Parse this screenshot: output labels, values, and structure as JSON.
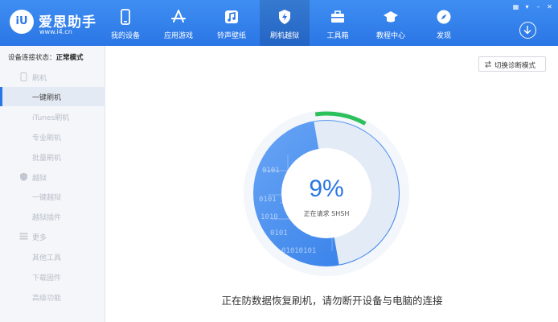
{
  "app": {
    "name": "爱思助手",
    "url": "www.i4.cn",
    "logo_mark": "iU"
  },
  "nav": [
    {
      "label": "我的设备",
      "icon": "phone-icon"
    },
    {
      "label": "应用游戏",
      "icon": "app-store-icon"
    },
    {
      "label": "铃声壁纸",
      "icon": "music-icon"
    },
    {
      "label": "刷机越狱",
      "icon": "flash-icon",
      "active": true
    },
    {
      "label": "工具箱",
      "icon": "toolbox-icon"
    },
    {
      "label": "教程中心",
      "icon": "graduation-cap-icon"
    },
    {
      "label": "发现",
      "icon": "compass-icon"
    }
  ],
  "window_controls": [
    "▦",
    "▾",
    "–",
    "✕"
  ],
  "sidebar": {
    "status_label": "设备连接状态：",
    "status_value": "正常模式",
    "sections": [
      {
        "label": "刷机",
        "icon": "flash-icon",
        "items": [
          "一键刷机",
          "iTunes刷机",
          "专业刷机",
          "批量刷机"
        ]
      },
      {
        "label": "越狱",
        "icon": "shield-icon",
        "items": [
          "一键越狱",
          "越狱插件"
        ]
      },
      {
        "label": "更多",
        "icon": "menu-icon",
        "items": [
          "其他工具",
          "下载固件",
          "高级功能"
        ]
      }
    ],
    "active_item": "一键刷机"
  },
  "main": {
    "diag_button": "切换诊断模式",
    "progress_percent": 9,
    "progress_text": "9%",
    "progress_sub": "正在请求 SHSH",
    "binary_lines": [
      "0101",
      "0101",
      "1010",
      "0101",
      "01010101"
    ],
    "message": "正在防数据恢复刷机，请勿断开设备与电脑的连接"
  },
  "colors": {
    "brand": "#2a76e6",
    "progress_green": "#2bc05a",
    "ring_light": "#e3ebf7"
  }
}
